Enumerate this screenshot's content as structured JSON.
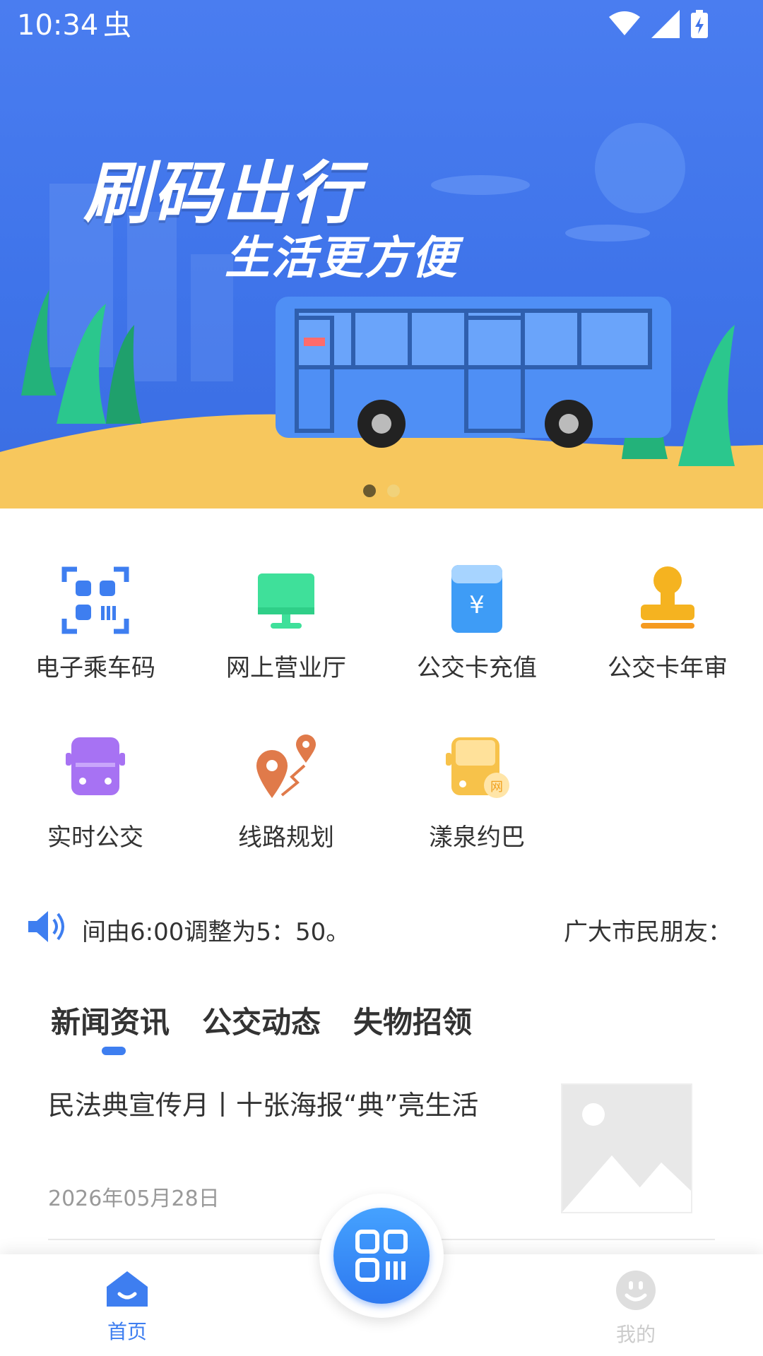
{
  "status_bar": {
    "time": "10:34",
    "bug_glyph": "虫"
  },
  "banner": {
    "title": "刷码出行",
    "subtitle": "生活更方便",
    "page_count": 2,
    "active_page": 1
  },
  "services": [
    {
      "label": "电子乘车码",
      "icon": "qr-code-icon",
      "color": "#3e7ef0"
    },
    {
      "label": "网上营业厅",
      "icon": "monitor-icon",
      "color": "#3fe09a"
    },
    {
      "label": "公交卡充值",
      "icon": "card-recharge-icon",
      "color": "#3e9cf6"
    },
    {
      "label": "公交卡年审",
      "icon": "stamp-icon",
      "color": "#f5b320"
    },
    {
      "label": "实时公交",
      "icon": "bus-icon",
      "color": "#a772f3"
    },
    {
      "label": "线路规划",
      "icon": "route-pin-icon",
      "color": "#e07a4a"
    },
    {
      "label": "漾泉约巴",
      "icon": "bus-booking-icon",
      "color": "#f7c24a"
    }
  ],
  "notice": {
    "text_left": "间由6:00调整为5：50。",
    "text_right": "广大市民朋友："
  },
  "tabs": [
    {
      "label": "新闻资讯",
      "active": true
    },
    {
      "label": "公交动态",
      "active": false
    },
    {
      "label": "失物招领",
      "active": false
    }
  ],
  "news": [
    {
      "title": "民法典宣传月丨十张海报“典”亮生活",
      "date": "2026年05月28日"
    }
  ],
  "navbar": {
    "home_label": "首页",
    "mine_label": "我的",
    "active_color": "#3e7ef0",
    "inactive_color": "#cccccc"
  }
}
